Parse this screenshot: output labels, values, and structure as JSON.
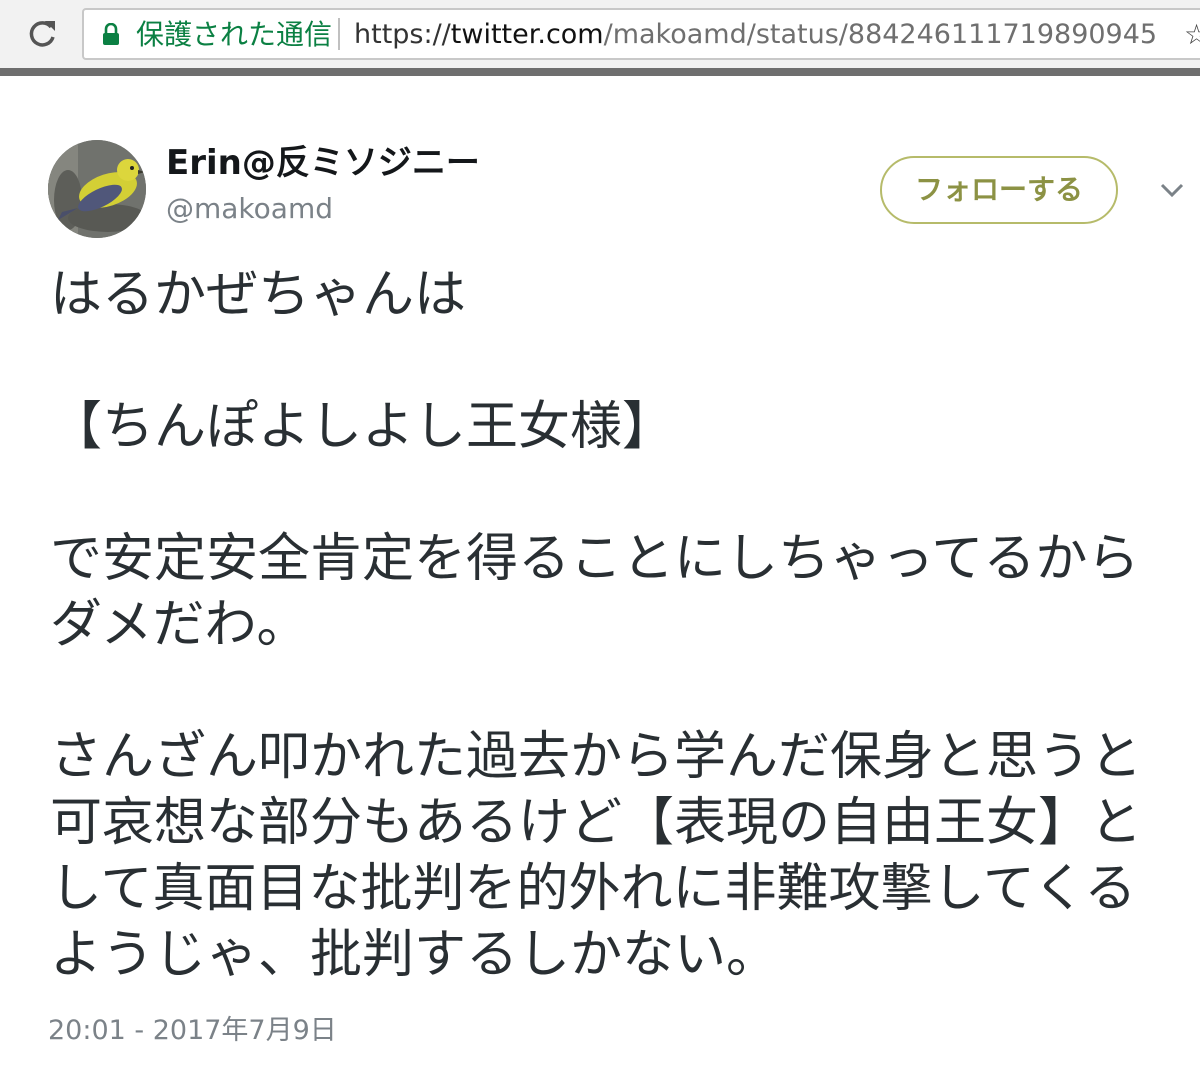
{
  "browser": {
    "secure_label": "保護された通信",
    "url_scheme": "https://",
    "url_host": "twitter.com",
    "url_path": "/makoamd/status/884246111719890945",
    "star_glyph": "☆"
  },
  "tweet": {
    "display_name": "Erin@反ミソジニー",
    "handle": "@makoamd",
    "follow_label": "フォローする",
    "paragraphs": [
      "はるかぜちゃんは",
      "【ちんぽよしよし王女様】",
      "で安定安全肯定を得ることにしちゃってるからダメだわ。",
      "さんざん叩かれた過去から学んだ保身と思うと可哀想な部分もあるけど【表現の自由王女】として真面目な批判を的外れに非難攻撃してくるようじゃ、批判するしかない。"
    ],
    "timestamp": "20:01 - 2017年7月9日"
  },
  "colors": {
    "secure_green": "#0b8043",
    "follow_accent": "#8c9244",
    "text_main": "#292f33",
    "text_muted": "#7b8288"
  },
  "icons": {
    "reload": "reload-icon",
    "lock": "lock-icon",
    "star": "star-icon",
    "caret": "chevron-down-icon",
    "avatar": "bird-avatar"
  }
}
